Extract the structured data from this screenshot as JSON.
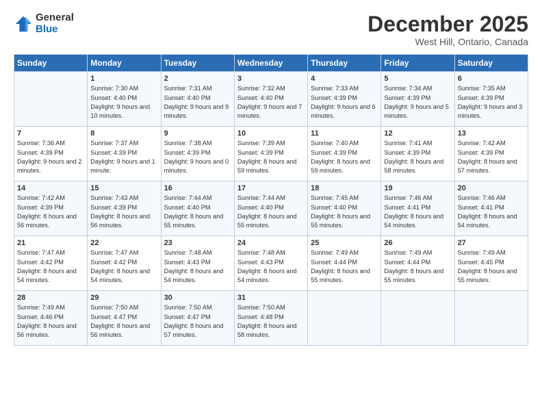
{
  "header": {
    "logo_general": "General",
    "logo_blue": "Blue",
    "main_title": "December 2025",
    "subtitle": "West Hill, Ontario, Canada"
  },
  "columns": [
    "Sunday",
    "Monday",
    "Tuesday",
    "Wednesday",
    "Thursday",
    "Friday",
    "Saturday"
  ],
  "weeks": [
    [
      {
        "day": "",
        "text": ""
      },
      {
        "day": "1",
        "text": "Sunrise: 7:30 AM\nSunset: 4:40 PM\nDaylight: 9 hours and 10 minutes."
      },
      {
        "day": "2",
        "text": "Sunrise: 7:31 AM\nSunset: 4:40 PM\nDaylight: 9 hours and 9 minutes."
      },
      {
        "day": "3",
        "text": "Sunrise: 7:32 AM\nSunset: 4:40 PM\nDaylight: 9 hours and 7 minutes."
      },
      {
        "day": "4",
        "text": "Sunrise: 7:33 AM\nSunset: 4:39 PM\nDaylight: 9 hours and 6 minutes."
      },
      {
        "day": "5",
        "text": "Sunrise: 7:34 AM\nSunset: 4:39 PM\nDaylight: 9 hours and 5 minutes."
      },
      {
        "day": "6",
        "text": "Sunrise: 7:35 AM\nSunset: 4:39 PM\nDaylight: 9 hours and 3 minutes."
      }
    ],
    [
      {
        "day": "7",
        "text": "Sunrise: 7:36 AM\nSunset: 4:39 PM\nDaylight: 9 hours and 2 minutes."
      },
      {
        "day": "8",
        "text": "Sunrise: 7:37 AM\nSunset: 4:39 PM\nDaylight: 9 hours and 1 minute."
      },
      {
        "day": "9",
        "text": "Sunrise: 7:38 AM\nSunset: 4:39 PM\nDaylight: 9 hours and 0 minutes."
      },
      {
        "day": "10",
        "text": "Sunrise: 7:39 AM\nSunset: 4:39 PM\nDaylight: 8 hours and 59 minutes."
      },
      {
        "day": "11",
        "text": "Sunrise: 7:40 AM\nSunset: 4:39 PM\nDaylight: 8 hours and 59 minutes."
      },
      {
        "day": "12",
        "text": "Sunrise: 7:41 AM\nSunset: 4:39 PM\nDaylight: 8 hours and 58 minutes."
      },
      {
        "day": "13",
        "text": "Sunrise: 7:42 AM\nSunset: 4:39 PM\nDaylight: 8 hours and 57 minutes."
      }
    ],
    [
      {
        "day": "14",
        "text": "Sunrise: 7:42 AM\nSunset: 4:39 PM\nDaylight: 8 hours and 56 minutes."
      },
      {
        "day": "15",
        "text": "Sunrise: 7:43 AM\nSunset: 4:39 PM\nDaylight: 8 hours and 56 minutes."
      },
      {
        "day": "16",
        "text": "Sunrise: 7:44 AM\nSunset: 4:40 PM\nDaylight: 8 hours and 55 minutes."
      },
      {
        "day": "17",
        "text": "Sunrise: 7:44 AM\nSunset: 4:40 PM\nDaylight: 8 hours and 55 minutes."
      },
      {
        "day": "18",
        "text": "Sunrise: 7:45 AM\nSunset: 4:40 PM\nDaylight: 8 hours and 55 minutes."
      },
      {
        "day": "19",
        "text": "Sunrise: 7:46 AM\nSunset: 4:41 PM\nDaylight: 8 hours and 54 minutes."
      },
      {
        "day": "20",
        "text": "Sunrise: 7:46 AM\nSunset: 4:41 PM\nDaylight: 8 hours and 54 minutes."
      }
    ],
    [
      {
        "day": "21",
        "text": "Sunrise: 7:47 AM\nSunset: 4:42 PM\nDaylight: 8 hours and 54 minutes."
      },
      {
        "day": "22",
        "text": "Sunrise: 7:47 AM\nSunset: 4:42 PM\nDaylight: 8 hours and 54 minutes."
      },
      {
        "day": "23",
        "text": "Sunrise: 7:48 AM\nSunset: 4:43 PM\nDaylight: 8 hours and 54 minutes."
      },
      {
        "day": "24",
        "text": "Sunrise: 7:48 AM\nSunset: 4:43 PM\nDaylight: 8 hours and 54 minutes."
      },
      {
        "day": "25",
        "text": "Sunrise: 7:49 AM\nSunset: 4:44 PM\nDaylight: 8 hours and 55 minutes."
      },
      {
        "day": "26",
        "text": "Sunrise: 7:49 AM\nSunset: 4:44 PM\nDaylight: 8 hours and 55 minutes."
      },
      {
        "day": "27",
        "text": "Sunrise: 7:49 AM\nSunset: 4:45 PM\nDaylight: 8 hours and 55 minutes."
      }
    ],
    [
      {
        "day": "28",
        "text": "Sunrise: 7:49 AM\nSunset: 4:46 PM\nDaylight: 8 hours and 56 minutes."
      },
      {
        "day": "29",
        "text": "Sunrise: 7:50 AM\nSunset: 4:47 PM\nDaylight: 8 hours and 56 minutes."
      },
      {
        "day": "30",
        "text": "Sunrise: 7:50 AM\nSunset: 4:47 PM\nDaylight: 8 hours and 57 minutes."
      },
      {
        "day": "31",
        "text": "Sunrise: 7:50 AM\nSunset: 4:48 PM\nDaylight: 8 hours and 58 minutes."
      },
      {
        "day": "",
        "text": ""
      },
      {
        "day": "",
        "text": ""
      },
      {
        "day": "",
        "text": ""
      }
    ]
  ]
}
